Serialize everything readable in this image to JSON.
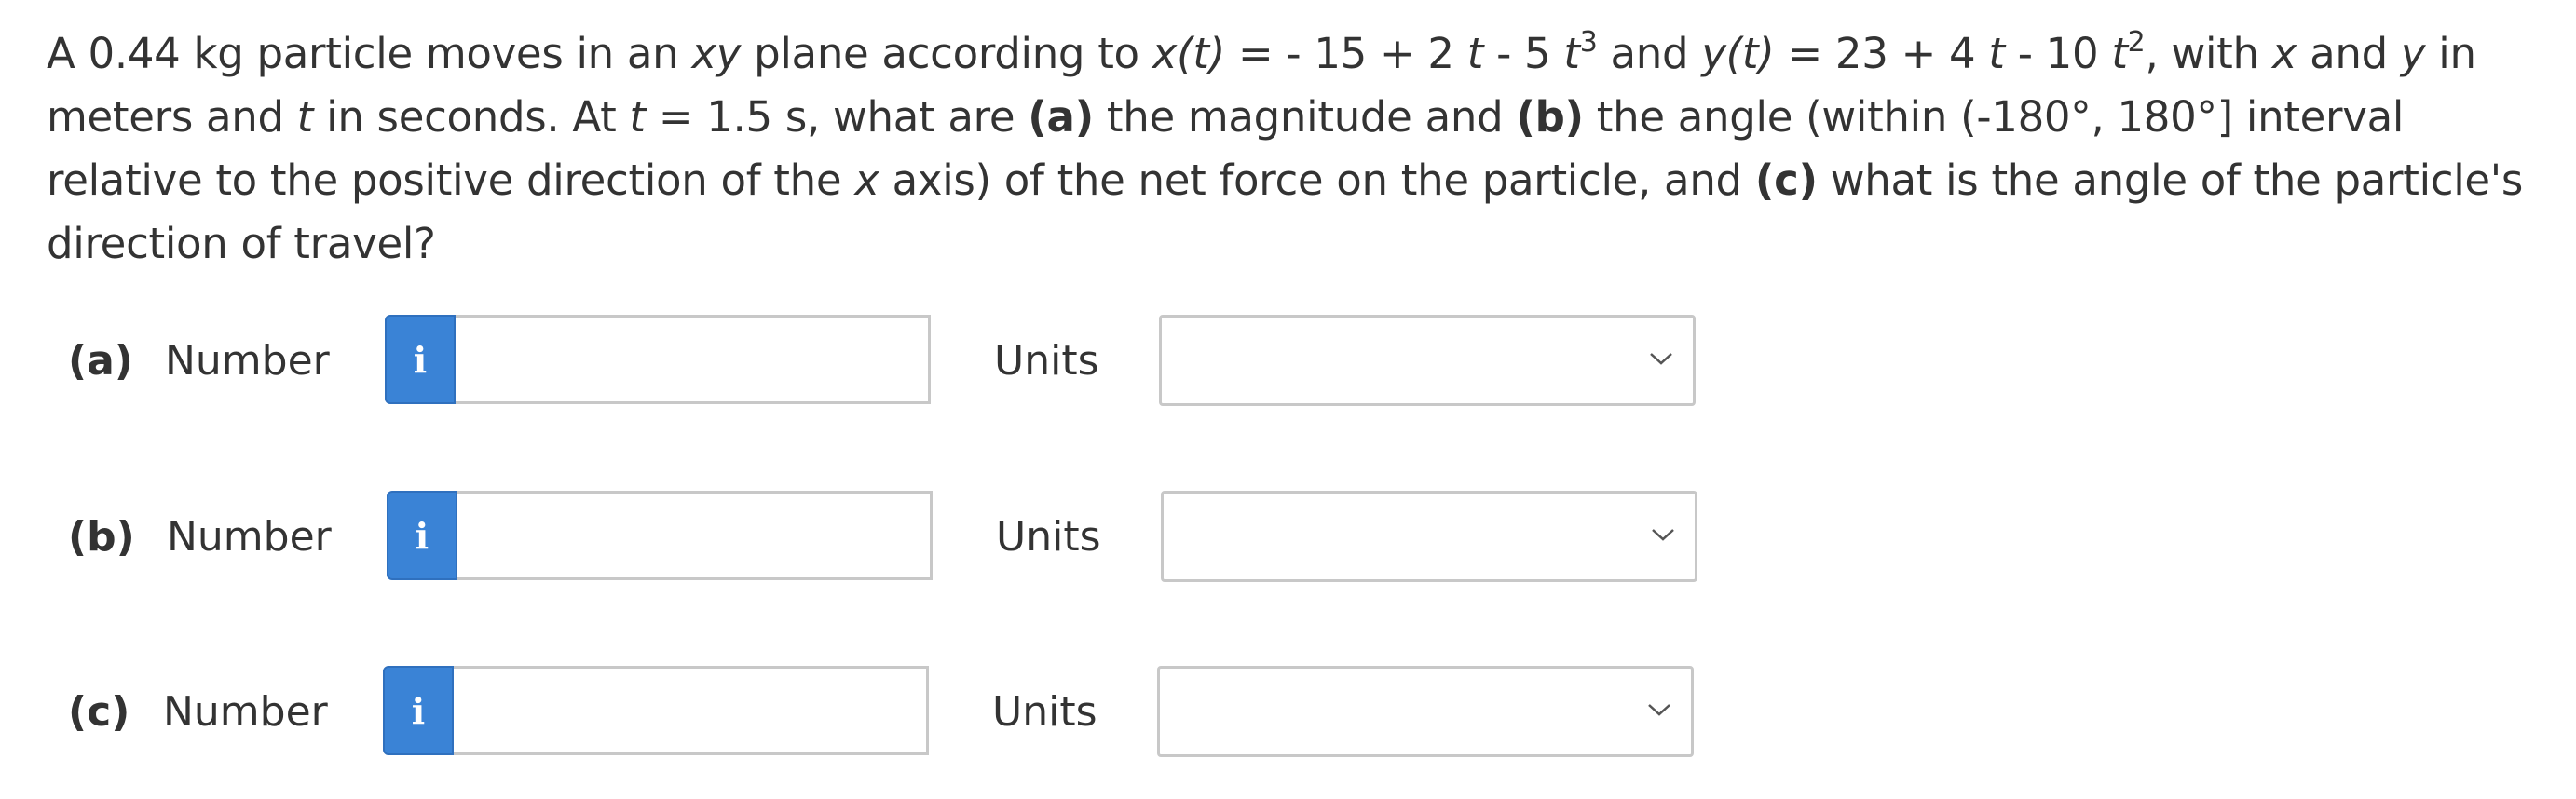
{
  "question": {
    "p1": "A 0.44 kg particle moves in an ",
    "xy": "xy",
    "p2": " plane according to ",
    "xt": "x(t)",
    "p3": " = - 15 + 2 ",
    "t1": "t",
    "p4": " - 5 ",
    "t2": "t",
    "exp3": "3",
    "p5": " and ",
    "yt": "y(t)",
    "p6": " = 23 + 4 ",
    "t3": "t",
    "p7": " - 10 ",
    "t4": "t",
    "exp2": "2",
    "p8": ", with ",
    "x1": "x",
    "p9": " and ",
    "y1": "y",
    "p10": " in meters and ",
    "t5": "t",
    "p11": " in seconds. At ",
    "t6": "t",
    "p12": " = 1.5 s, what are ",
    "a": "(a)",
    "p13": " the magnitude and ",
    "b": "(b)",
    "p14": " the angle (within (-180°, 180°] interval relative to the positive direction of the ",
    "x2": "x",
    "p15": " axis) of the net force on the particle, and ",
    "c": "(c)",
    "p16": " what is the angle of the particle's direction of travel?"
  },
  "parts": [
    {
      "label": "(a)",
      "number_label": "Number",
      "info_icon": "i",
      "number_value": "",
      "units_label": "Units",
      "units_value": ""
    },
    {
      "label": "(b)",
      "number_label": "Number",
      "info_icon": "i",
      "number_value": "",
      "units_label": "Units",
      "units_value": ""
    },
    {
      "label": "(c)",
      "number_label": "Number",
      "info_icon": "i",
      "number_value": "",
      "units_label": "Units",
      "units_value": ""
    }
  ],
  "colors": {
    "info_button": "#3a83d6",
    "text": "#333333",
    "border": "#c8c8c8"
  }
}
